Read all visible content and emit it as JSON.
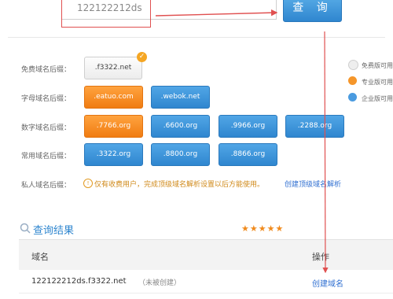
{
  "search": {
    "value": "122122212ds",
    "button_label": "查 询"
  },
  "rows": [
    {
      "label": "免费域名后缀：",
      "chips": [
        {
          "text": ".f3322.net",
          "style": "gray",
          "checked": true
        }
      ]
    },
    {
      "label": "字母域名后缀：",
      "chips": [
        {
          "text": ".eatuo.com",
          "style": "orange"
        },
        {
          "text": ".webok.net",
          "style": "blue"
        }
      ]
    },
    {
      "label": "数字域名后缀：",
      "chips": [
        {
          "text": ".7766.org",
          "style": "orange"
        },
        {
          "text": ".6600.org",
          "style": "blue"
        },
        {
          "text": ".9966.org",
          "style": "blue"
        },
        {
          "text": ".2288.org",
          "style": "blue"
        }
      ]
    },
    {
      "label": "常用域名后缀：",
      "chips": [
        {
          "text": ".3322.org",
          "style": "blue"
        },
        {
          "text": ".8800.org",
          "style": "blue"
        },
        {
          "text": ".8866.org",
          "style": "blue"
        }
      ]
    }
  ],
  "legend": [
    {
      "text": "免费版可用",
      "color": "#e8e8e8"
    },
    {
      "text": "专业版可用",
      "color": "#f5962a"
    },
    {
      "text": "企业版可用",
      "color": "#4a9be0"
    }
  ],
  "private": {
    "label": "私人域名后缀：",
    "notice": "仅有收费用户，完成顶级域名解析设置以后方能使用。",
    "link": "创建顶级域名解析"
  },
  "results": {
    "title": "查询结果",
    "columns": [
      "域名",
      "操作"
    ],
    "rows": [
      {
        "domain": "122122212ds.f3322.net",
        "status": "（未被创建）",
        "action": "创建域名"
      }
    ]
  },
  "colors": {
    "accent": "#2f86cf",
    "orange": "#f07c12",
    "annotation": "#e05050"
  }
}
